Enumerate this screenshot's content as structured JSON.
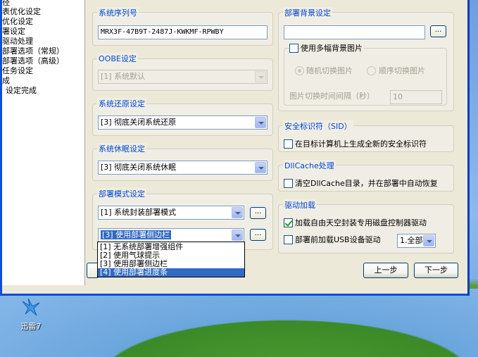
{
  "sidebar": {
    "items": [
      "径",
      "表优化设定",
      "优化设定",
      "署设定",
      "驱动处理",
      "部署选项（常规）",
      "部署选项（高级）",
      "任务设定",
      "成",
      "设定完成"
    ]
  },
  "serial": {
    "title": "系统序列号",
    "value": "MRX3F-47B9T-2487J-KWKMF-RPWBY"
  },
  "oobe": {
    "title": "OOBE设定",
    "value": "[1] 系统默认"
  },
  "restore": {
    "title": "系统还原设定",
    "value": "[3] 彻底关闭系统还原"
  },
  "hibernate": {
    "title": "系统休眠设定",
    "value": "[3] 彻底关闭系统休眠"
  },
  "deploy_mode": {
    "title": "部署模式设定",
    "mode_value": "[1] 系统封装部署模式",
    "ui_value": "[3] 使用部署侧边栏",
    "browse_label": "...",
    "options": [
      "[1] 无系统部署增强组件",
      "[2] 使用气球提示",
      "[3] 使用部署侧边栏",
      "[4] 使用部署进度条"
    ]
  },
  "background": {
    "title": "部署背景设定",
    "path_value": "",
    "browse_label": "...",
    "multi_label": "使用多幅背景图片",
    "random_label": "随机切换图片",
    "sequential_label": "顺序切换图片",
    "interval_label": "图片切换时间间隔（秒）",
    "interval_value": "10"
  },
  "sid": {
    "title": "安全标识符（SID）",
    "label": "在目标计算机上生成全新的安全标识符"
  },
  "dllcache": {
    "title": "DllCache处理",
    "label": "清空DllCache目录，并在部署中自动恢复"
  },
  "driver": {
    "title": "驱动加载",
    "disk_label": "加载自由天空封装专用磁盘控制器驱动",
    "usb_label": "部署前加载USB设备驱动",
    "usb_value": "1.全部"
  },
  "nav": {
    "prev_label": "上一步",
    "next_label": "下一步"
  },
  "desktop": {
    "icon_label": "迅雷7"
  },
  "colors": {
    "group_title": "#0046d5",
    "selection": "#316ac5",
    "window_frame": "#0b4fd8"
  }
}
